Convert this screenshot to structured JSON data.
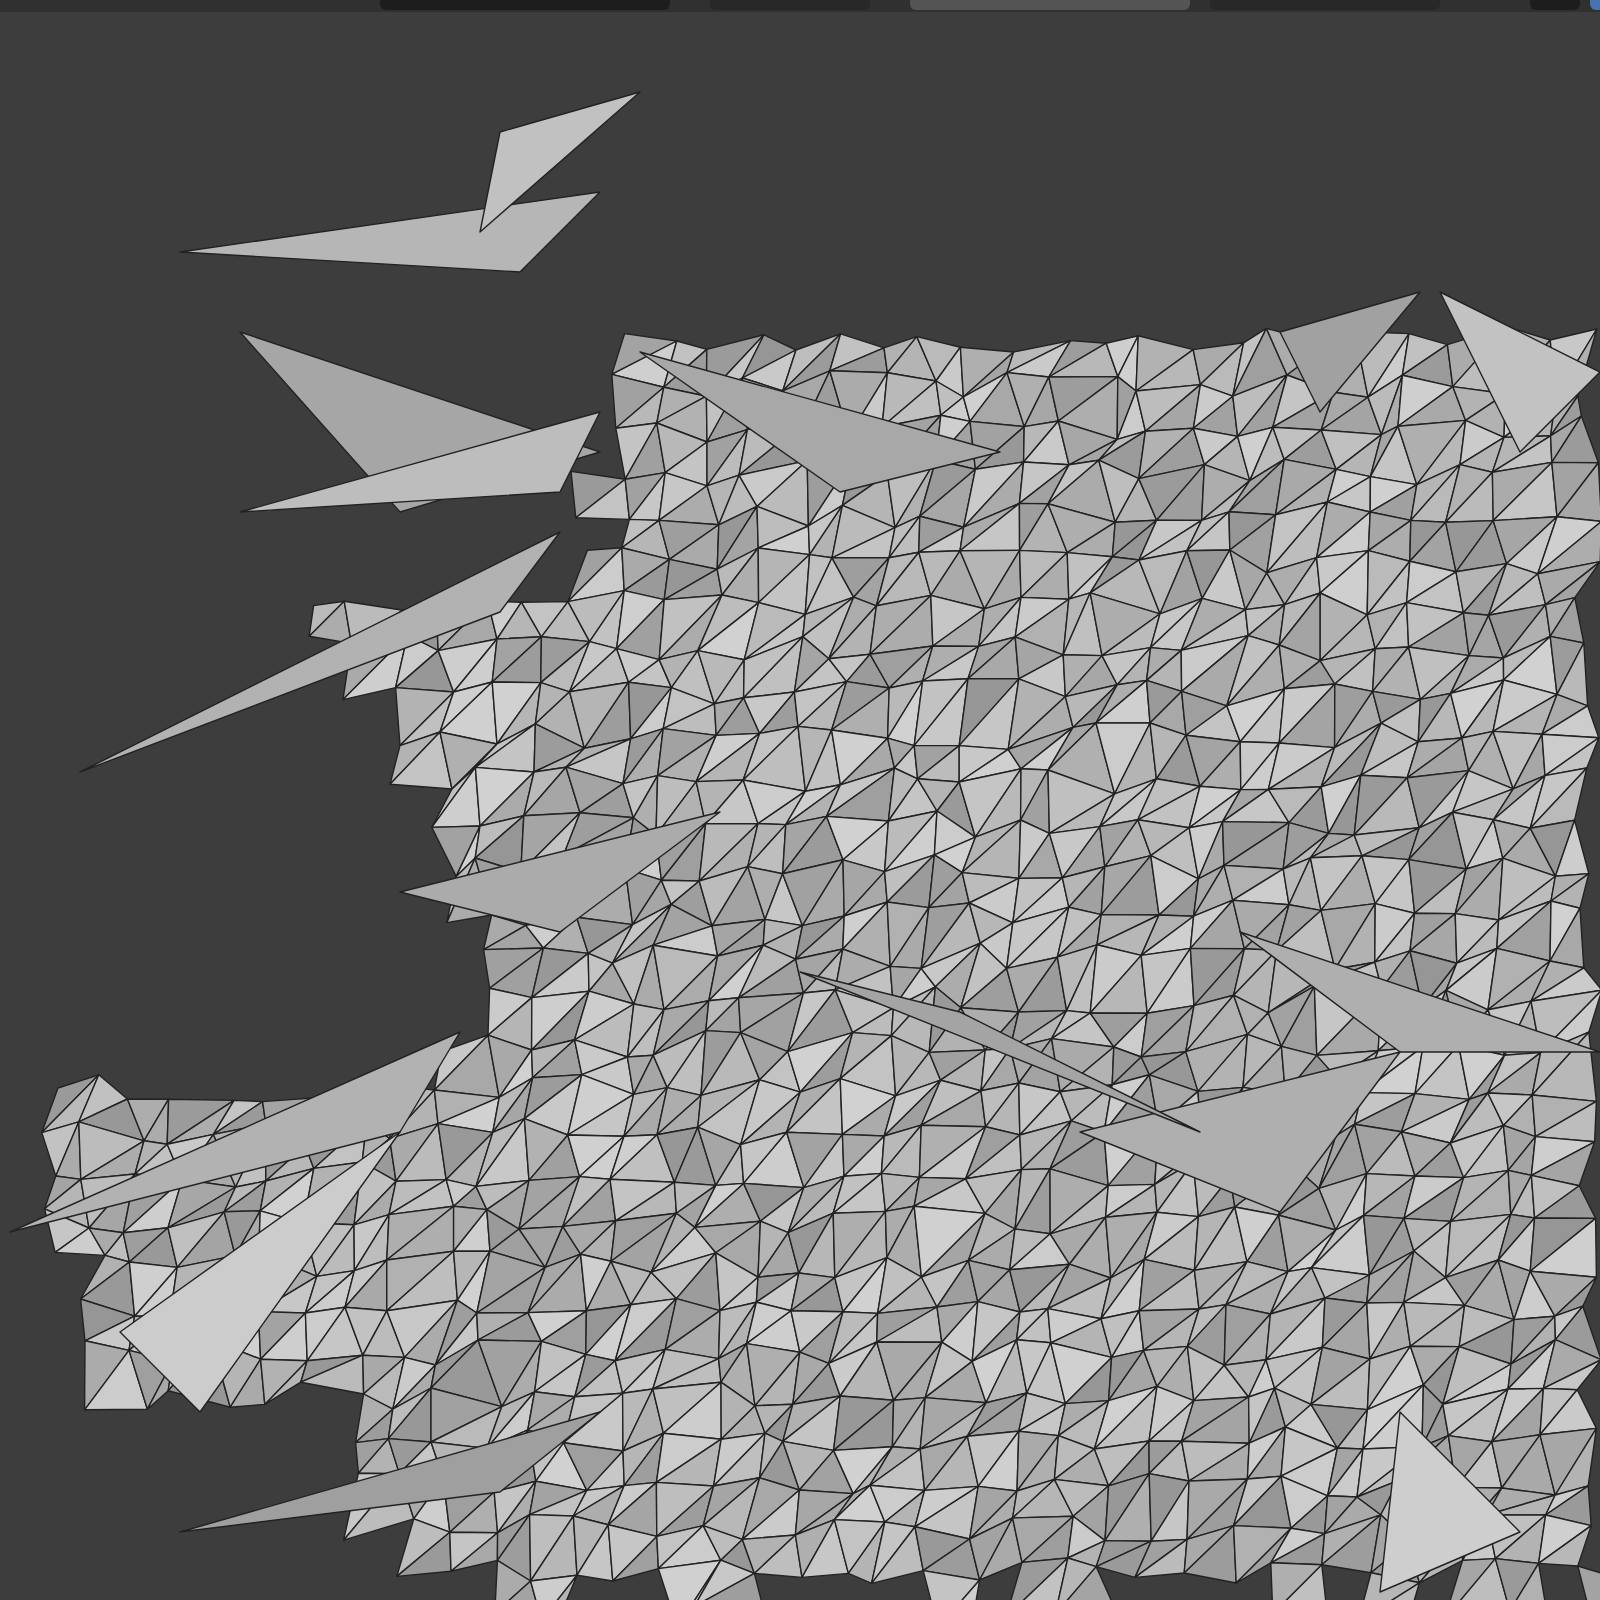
{
  "viewport_header": {
    "controls": [
      {
        "kind": "dropdown",
        "selected": false
      },
      {
        "kind": "icon_group",
        "selected": false
      },
      {
        "kind": "toggle_group",
        "selected": true
      },
      {
        "kind": "toggle_group",
        "selected": false
      },
      {
        "kind": "dropdown_small",
        "selected": false
      },
      {
        "kind": "blue_icon",
        "selected": false
      }
    ]
  },
  "viewport": {
    "wireframe": true
  }
}
